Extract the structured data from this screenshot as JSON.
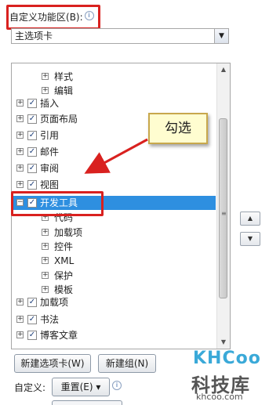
{
  "header": {
    "title": "自定义功能区",
    "shortcut": "(B):",
    "info_glyph": "i"
  },
  "dropdown": {
    "value": "主选项卡",
    "arrow": "▼"
  },
  "tree": {
    "rows": [
      {
        "label": "样式",
        "checked": false
      },
      {
        "label": "编辑",
        "checked": false
      },
      {
        "label": "插入",
        "checked": true
      },
      {
        "label": "页面布局",
        "checked": true
      },
      {
        "label": "引用",
        "checked": true
      },
      {
        "label": "邮件",
        "checked": true
      },
      {
        "label": "审阅",
        "checked": true
      },
      {
        "label": "视图",
        "checked": true
      },
      {
        "label": "开发工具",
        "checked": true,
        "selected": true
      },
      {
        "label": "代码",
        "checked": false
      },
      {
        "label": "加载项",
        "checked": false
      },
      {
        "label": "控件",
        "checked": false
      },
      {
        "label": "XML",
        "checked": false
      },
      {
        "label": "保护",
        "checked": false
      },
      {
        "label": "模板",
        "checked": false
      },
      {
        "label": "加载项",
        "checked": true
      },
      {
        "label": "书法",
        "checked": true
      },
      {
        "label": "博客文章",
        "checked": true
      }
    ],
    "expand_glyph": "+",
    "collapse_glyph": "−",
    "check_glyph": "✓"
  },
  "callout": {
    "text": "勾选"
  },
  "side_buttons": {
    "up": "▲",
    "down": "▼"
  },
  "buttons": {
    "new_tab": "新建选项卡(W)",
    "new_group": "新建组(N)",
    "customize_label": "自定义:",
    "reset": "重置(E) ▾"
  },
  "watermark": {
    "logo": "KHCoo",
    "cn": "科技库",
    "url": "khcoo.com"
  },
  "colors": {
    "selection": "#2e8fe0",
    "highlight_box": "#d9211f",
    "arrow": "#d9211f"
  }
}
